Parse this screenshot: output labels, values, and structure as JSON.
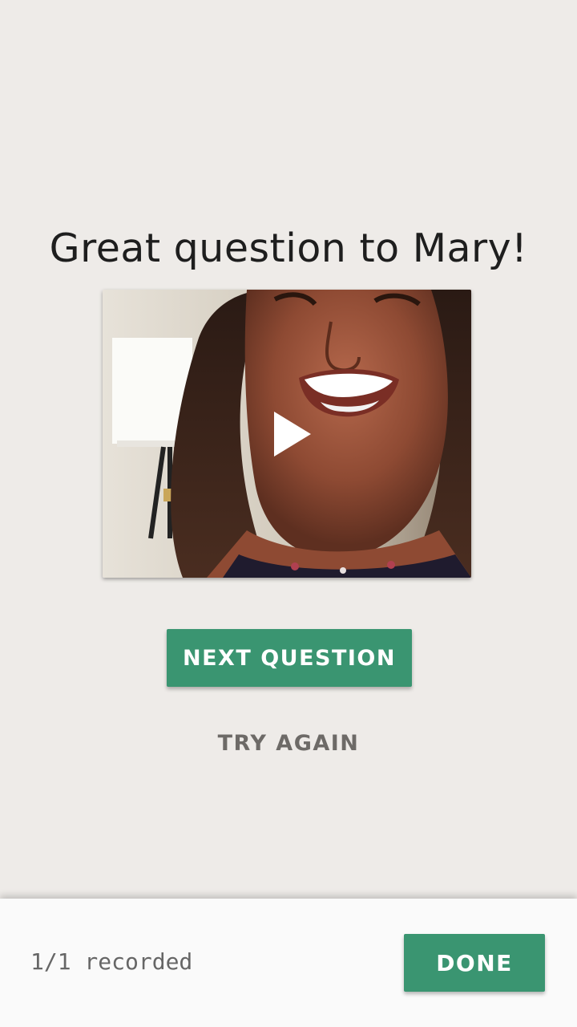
{
  "header": {
    "title": "Great question to Mary!"
  },
  "video": {
    "icon": "play-icon"
  },
  "actions": {
    "next_label": "NEXT QUESTION",
    "retry_label": "TRY AGAIN"
  },
  "footer": {
    "status": "1/1 recorded",
    "done_label": "DONE"
  },
  "colors": {
    "background": "#eeebe8",
    "accent": "#3a9571",
    "footer_bg": "#fafafa",
    "secondary_text": "#6d6a67"
  }
}
